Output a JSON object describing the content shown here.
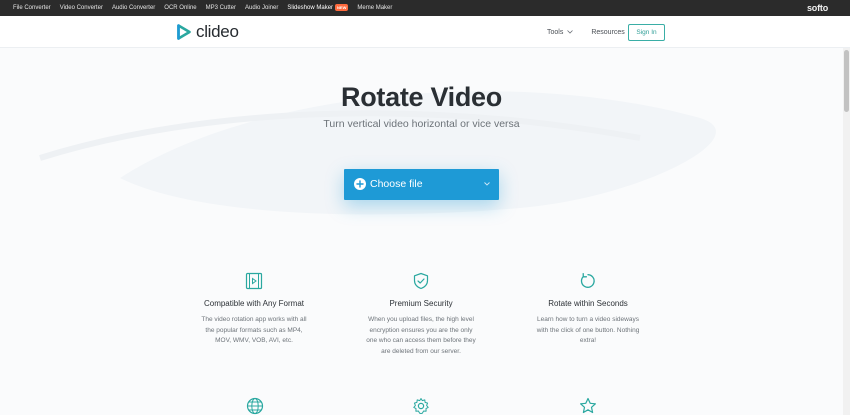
{
  "topbar": {
    "links": [
      "File Converter",
      "Video Converter",
      "Audio Converter",
      "OCR Online",
      "MP3 Cutter",
      "Audio Joiner",
      "Slideshow Maker",
      "Meme Maker"
    ],
    "new_badge": "NEW",
    "brand": "softo"
  },
  "header": {
    "logo_text": "clideo",
    "nav_tools": "Tools",
    "nav_resources": "Resources",
    "signin": "Sign In"
  },
  "hero": {
    "title": "Rotate Video",
    "subtitle": "Turn vertical video horizontal or vice versa",
    "choose_label": "Choose file"
  },
  "features": [
    {
      "icon": "video-file-icon",
      "title": "Compatible with Any Format",
      "desc": "The video rotation app works with all the popular formats such as MP4, MOV, WMV, VOB, AVI, etc."
    },
    {
      "icon": "shield-check-icon",
      "title": "Premium Security",
      "desc": "When you upload files, the high level encryption ensures you are the only one who can access them before they are deleted from our server."
    },
    {
      "icon": "rotate-icon",
      "title": "Rotate within Seconds",
      "desc": "Learn how to turn a video sideways with the click of one button. Nothing extra!"
    }
  ],
  "colors": {
    "accent": "#1e9ad6",
    "teal": "#2f9e97",
    "topbar": "#2b2b2b",
    "badge": "#ff6a3d"
  }
}
